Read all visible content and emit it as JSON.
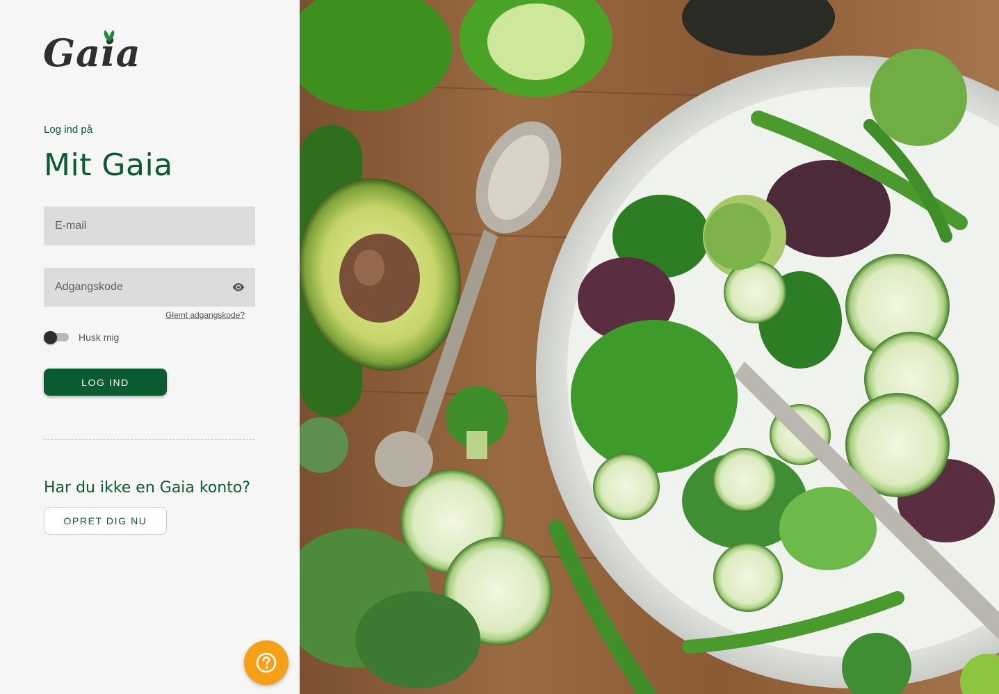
{
  "brand": {
    "logo_text": "Gaia",
    "logo_icon": "leaf-icon"
  },
  "login": {
    "subtitle": "Log ind på",
    "title": "Mit Gaia",
    "email_placeholder": "E-mail",
    "password_placeholder": "Adgangskode",
    "forgot_password": "Glemt adgangskode?",
    "remember_me": "Husk mig",
    "remember_me_checked": false,
    "submit_label": "LOG IND"
  },
  "signup": {
    "heading": "Har du ikke en Gaia konto?",
    "button_label": "OPRET DIG NU"
  },
  "help": {
    "icon": "question-icon"
  },
  "colors": {
    "brand_green": "#0a5a32",
    "help_orange": "#f5a016",
    "panel_bg": "#f6f6f6",
    "input_bg": "#dcdcdc"
  }
}
